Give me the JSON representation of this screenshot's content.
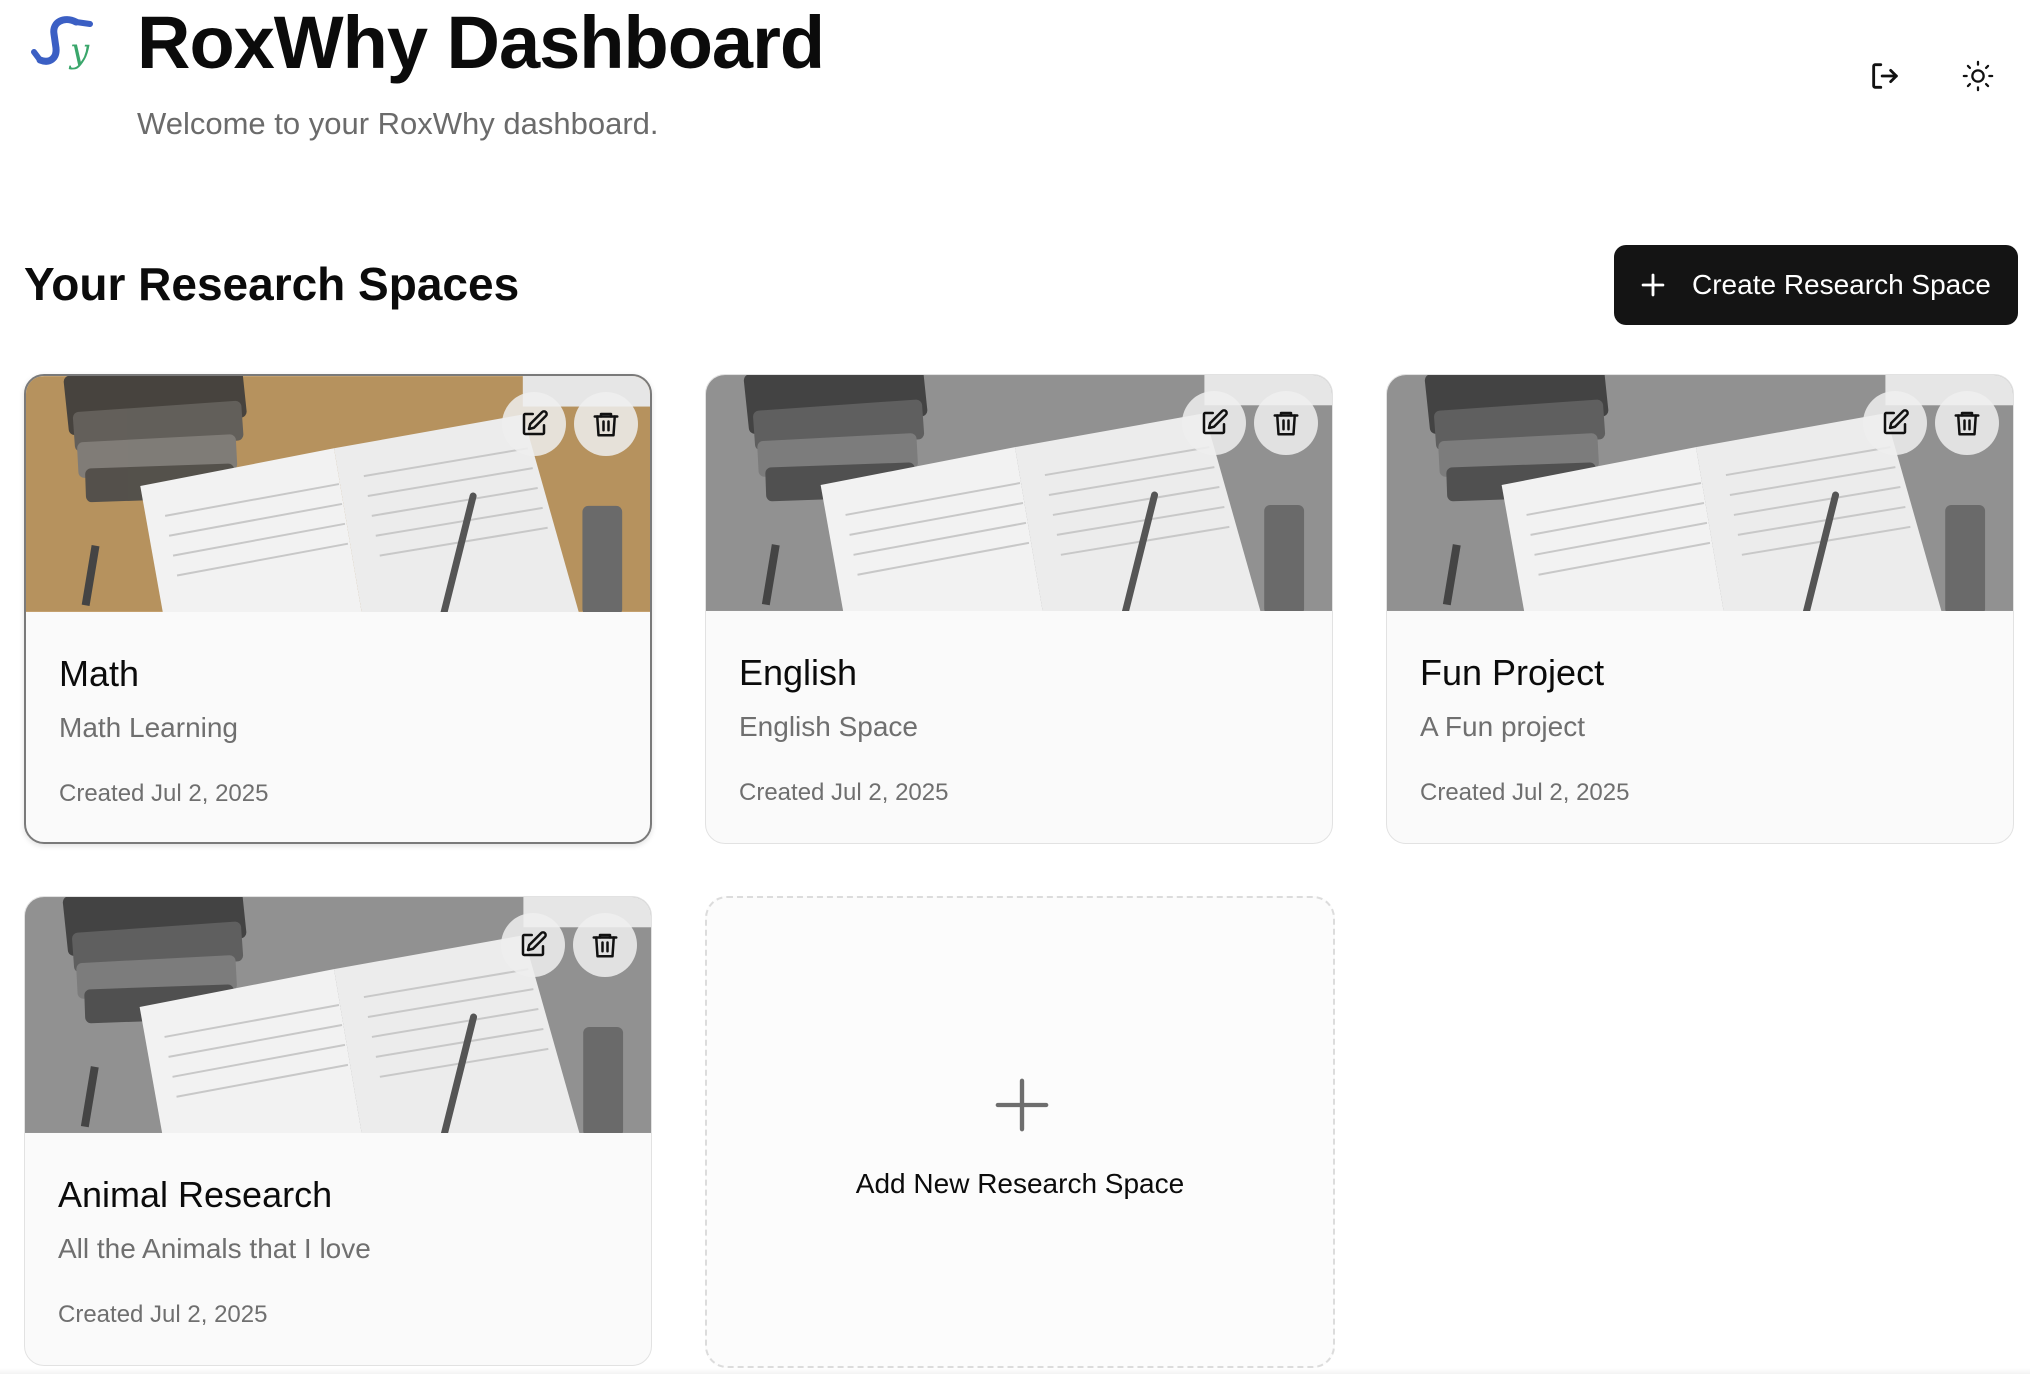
{
  "header": {
    "title": "RoxWhy Dashboard",
    "subtitle": "Welcome to your RoxWhy dashboard.",
    "logo_icon": "roxwhy-logo",
    "logout_icon": "logout-icon",
    "theme_icon": "sun-icon"
  },
  "section": {
    "title": "Your Research Spaces",
    "create_label": "Create Research Space"
  },
  "spaces": [
    {
      "name": "Math",
      "description": "Math Learning",
      "created": "Created Jul 2, 2025",
      "tint": "sepia"
    },
    {
      "name": "English",
      "description": "English Space",
      "created": "Created Jul 2, 2025",
      "tint": "grayscale"
    },
    {
      "name": "Fun Project",
      "description": "A Fun project",
      "created": "Created Jul 2, 2025",
      "tint": "grayscale"
    },
    {
      "name": "Animal Research",
      "description": "All the Animals that I love",
      "created": "Created Jul 2, 2025",
      "tint": "grayscale"
    }
  ],
  "add_card": {
    "label": "Add New Research Space"
  },
  "colors": {
    "primary_button": "#141414",
    "logo_blue": "#3b5fc4",
    "logo_green": "#3aa66b",
    "muted_text": "#6f6f6f"
  }
}
